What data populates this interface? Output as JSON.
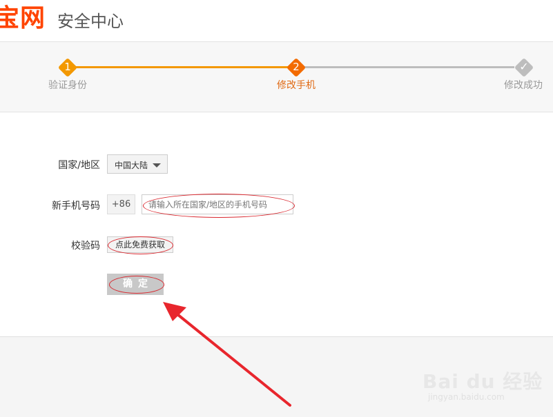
{
  "header": {
    "logo_text": "宝网",
    "title": "安全中心"
  },
  "steps": [
    {
      "number": "1",
      "label": "验证身份",
      "state": "done"
    },
    {
      "number": "2",
      "label": "修改手机",
      "state": "current"
    },
    {
      "number": "✓",
      "label": "修改成功",
      "state": "pending"
    }
  ],
  "form": {
    "country": {
      "label": "国家/地区",
      "value": "中国大陆"
    },
    "phone": {
      "label": "新手机号码",
      "prefix": "+86",
      "placeholder": "请输入所在国家/地区的手机号码"
    },
    "code": {
      "label": "校验码",
      "button": "点此免费获取"
    },
    "confirm_label": "确定"
  },
  "watermark": {
    "main": "Bai du 经验",
    "sub": "jingyan.baidu.com"
  },
  "colors": {
    "brand": "#ff4400",
    "step_active": "#f39800",
    "annotation": "#e8262d"
  }
}
